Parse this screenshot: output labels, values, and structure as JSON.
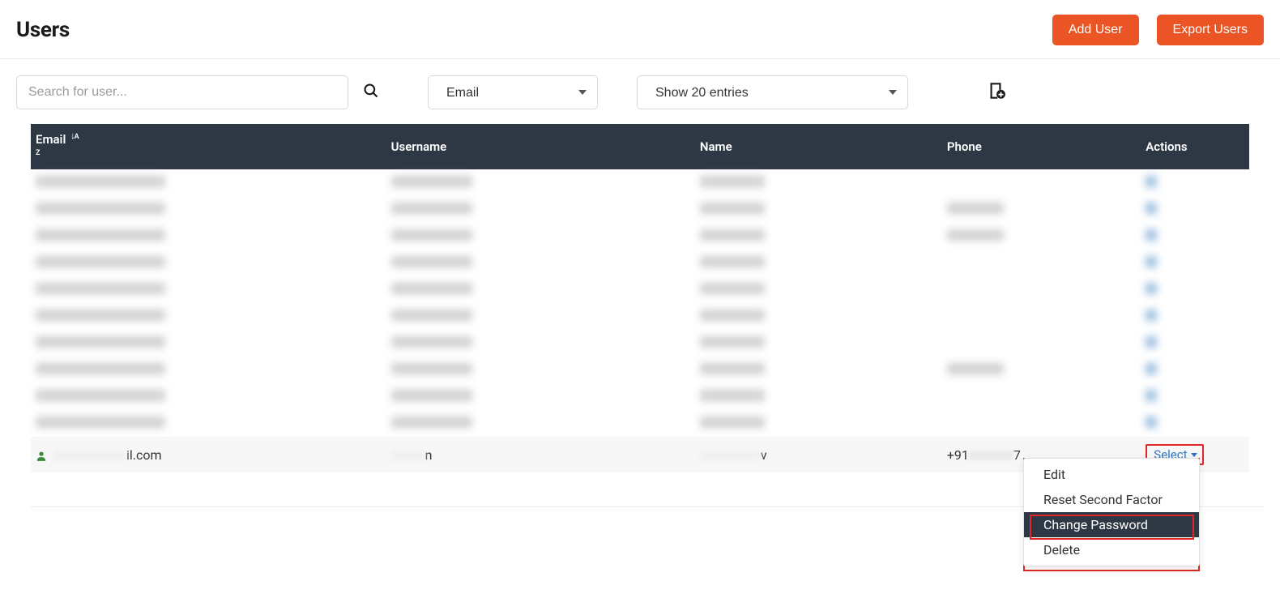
{
  "header": {
    "title": "Users",
    "add_user_label": "Add User",
    "export_users_label": "Export Users"
  },
  "filters": {
    "search_placeholder": "Search for user...",
    "filter_by_selected": "Email",
    "entries_selected": "Show 20 entries"
  },
  "table": {
    "headers": {
      "email": "Email",
      "username": "Username",
      "name": "Name",
      "phone": "Phone",
      "actions": "Actions"
    },
    "blurred_rows": [
      {
        "email": "a",
        "username": "a",
        "name": "a",
        "phone": ""
      },
      {
        "email": "a",
        "username": "a",
        "name": "a",
        "phone": "a"
      },
      {
        "email": "a",
        "username": "a",
        "name": "a",
        "phone": "a"
      },
      {
        "email": "a",
        "username": "a",
        "name": "a",
        "phone": ""
      },
      {
        "email": "a",
        "username": "a",
        "name": "a",
        "phone": ""
      },
      {
        "email": "a",
        "username": "a",
        "name": "a",
        "phone": ""
      },
      {
        "email": "a",
        "username": "a",
        "name": "a",
        "phone": ""
      },
      {
        "email": "a",
        "username": "a",
        "name": "a",
        "phone": "a"
      },
      {
        "email": "a",
        "username": "a",
        "name": "a",
        "phone": ""
      },
      {
        "email": "a",
        "username": "a",
        "name": "a",
        "phone": ""
      }
    ],
    "visible_row": {
      "email_suffix": "il.com",
      "username_suffix": "n",
      "name_suffix": "v",
      "phone_prefix": "+91",
      "phone_suffix": "7",
      "action_label": "Select"
    }
  },
  "dropdown": {
    "items": [
      {
        "label": "Edit",
        "active": false
      },
      {
        "label": "Reset Second Factor",
        "active": false
      },
      {
        "label": "Change Password",
        "active": true
      },
      {
        "label": "Delete",
        "active": false
      }
    ]
  }
}
